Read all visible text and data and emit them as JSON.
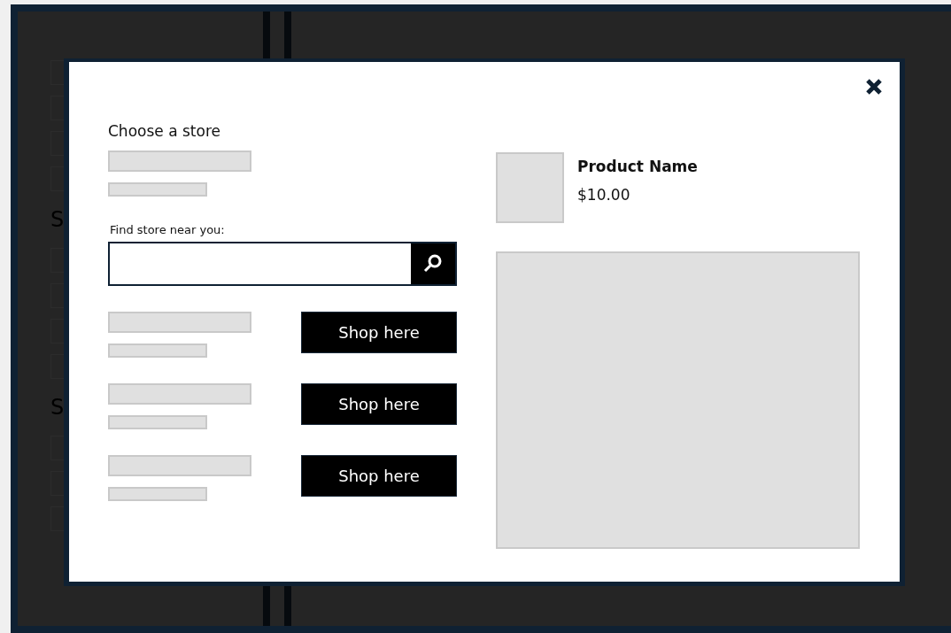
{
  "background": {
    "headings": [
      {
        "text": "S"
      },
      {
        "text": "S"
      }
    ]
  },
  "modal": {
    "title": "Choose a store",
    "search": {
      "label": "Find store near you:"
    },
    "stores": [
      {
        "button": "Shop here"
      },
      {
        "button": "Shop here"
      },
      {
        "button": "Shop here"
      }
    ],
    "product": {
      "name": "Product Name",
      "price": "$10.00"
    }
  }
}
